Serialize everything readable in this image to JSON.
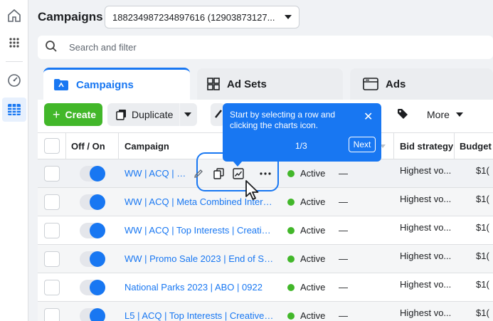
{
  "header": {
    "title": "Campaigns",
    "account_value": "188234987234897616 (12903873127..."
  },
  "search": {
    "placeholder": "Search and filter"
  },
  "tabs": [
    {
      "label": "Campaigns",
      "active": true
    },
    {
      "label": "Ad Sets",
      "active": false
    },
    {
      "label": "Ads",
      "active": false
    }
  ],
  "toolbar": {
    "create_label": "Create",
    "duplicate_label": "Duplicate",
    "more_label": "More"
  },
  "tooltip": {
    "text": "Start by selecting a row and clicking the charts icon.",
    "step": "1/3",
    "next_label": "Next"
  },
  "table": {
    "headers": {
      "offon": "Off / On",
      "campaign": "Campaign",
      "bid": "Bid strategy",
      "budget": "Budget"
    },
    "rows": [
      {
        "name": "WW | ACQ | E...",
        "delivery": "Active",
        "results": "—",
        "bid": "Highest vo...",
        "budget": "$1(",
        "on": true
      },
      {
        "name": "WW | ACQ | Meta Combined Interes...",
        "delivery": "Active",
        "results": "—",
        "bid": "Highest vo...",
        "budget": "$1(",
        "on": true
      },
      {
        "name": "WW | ACQ | Top Interests | Creative...",
        "delivery": "Active",
        "results": "—",
        "bid": "Highest vo...",
        "budget": "$1(",
        "on": true
      },
      {
        "name": "WW | Promo Sale 2023 | End of Sea...",
        "delivery": "Active",
        "results": "—",
        "bid": "Highest vo...",
        "budget": "$1(",
        "on": true
      },
      {
        "name": "National Parks 2023 | ABO | 0922",
        "delivery": "Active",
        "results": "—",
        "bid": "Highest vo...",
        "budget": "$1(",
        "on": true
      },
      {
        "name": "L5 | ACQ | Top Interests | Creative T...",
        "delivery": "Active",
        "results": "—",
        "bid": "Highest vo...",
        "budget": "$1(",
        "on": true
      }
    ]
  },
  "colors": {
    "accent": "#1877f2",
    "create": "#42b72a",
    "active_dot": "#42b72a"
  }
}
